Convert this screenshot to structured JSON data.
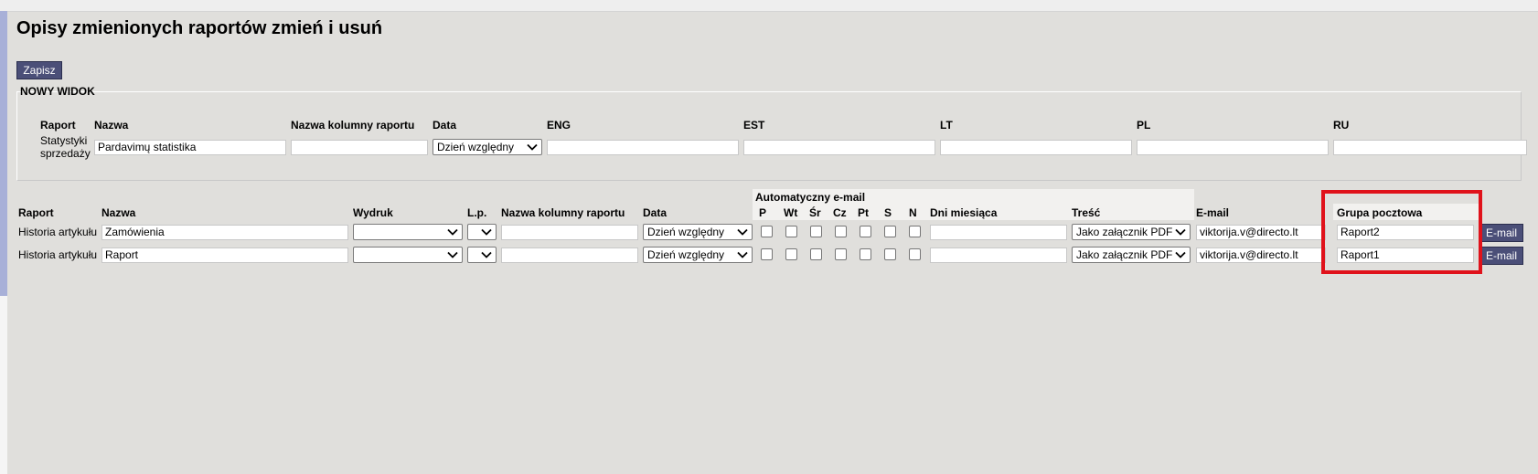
{
  "page": {
    "title": "Opisy zmienionych raportów zmień i usuń",
    "save_label": "Zapisz"
  },
  "new_view": {
    "section_label": "NOWY WIDOK",
    "headers": {
      "raport": "Raport",
      "nazwa": "Nazwa",
      "kolumna": "Nazwa kolumny raportu",
      "data": "Data",
      "eng": "ENG",
      "est": "EST",
      "lt": "LT",
      "pl": "PL",
      "ru": "RU"
    },
    "row": {
      "raport_line1": "Statystyki",
      "raport_line2": "sprzedaży",
      "nazwa": "Pardavimų statistika",
      "kolumna": "",
      "data": "Dzień względny",
      "eng": "",
      "est": "",
      "lt": "",
      "pl": "",
      "ru": ""
    }
  },
  "list": {
    "auto_email_label": "Automatyczny e-mail",
    "headers": {
      "raport": "Raport",
      "nazwa": "Nazwa",
      "wydruk": "Wydruk",
      "lp": "L.p.",
      "kolumna": "Nazwa kolumny raportu",
      "data": "Data",
      "days": [
        "P",
        "Wt",
        "Śr",
        "Cz",
        "Pt",
        "S",
        "N"
      ],
      "dni": "Dni miesiąca",
      "tresc": "Treść",
      "email": "E-mail",
      "grupa": "Grupa pocztowa"
    },
    "rows": [
      {
        "raport": "Historia artykułu",
        "nazwa": "Zamówienia",
        "wydruk": "",
        "lp": "",
        "kolumna": "",
        "data": "Dzień względny",
        "dni": "",
        "tresc": "Jako załącznik PDF",
        "email": "viktorija.v@directo.lt",
        "grupa": "Raport2",
        "email_button": "E-mail"
      },
      {
        "raport": "Historia artykułu",
        "nazwa": "Raport",
        "wydruk": "",
        "lp": "",
        "kolumna": "",
        "data": "Dzień względny",
        "dni": "",
        "tresc": "Jako załącznik PDF",
        "email": "viktorija.v@directo.lt",
        "grupa": "Raport1",
        "email_button": "E-mail"
      }
    ]
  },
  "colors": {
    "background": "#e0dfdc",
    "button": "#4b4f78",
    "highlight": "#e0121b"
  }
}
